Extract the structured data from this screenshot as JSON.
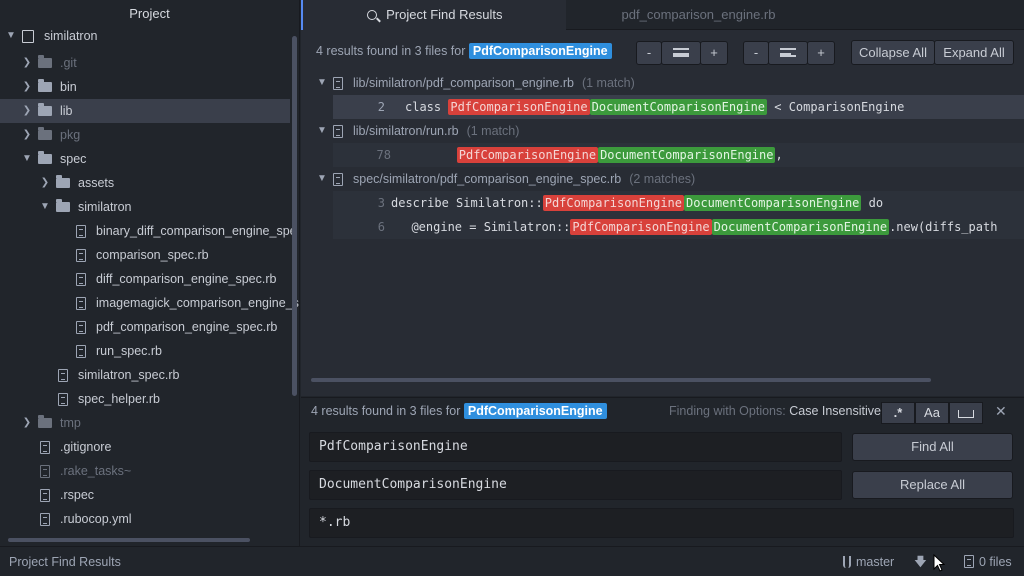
{
  "tree": {
    "title": "Project",
    "root": "similatron",
    "items": [
      {
        "label": ".git",
        "type": "folder"
      },
      {
        "label": "bin",
        "type": "folder"
      },
      {
        "label": "lib",
        "type": "folder"
      },
      {
        "label": "pkg",
        "type": "folder"
      },
      {
        "label": "spec",
        "type": "folder"
      },
      {
        "label": "assets",
        "type": "folder"
      },
      {
        "label": "similatron",
        "type": "folder"
      },
      {
        "label": "binary_diff_comparison_engine_spe",
        "type": "file"
      },
      {
        "label": "comparison_spec.rb",
        "type": "file"
      },
      {
        "label": "diff_comparison_engine_spec.rb",
        "type": "file"
      },
      {
        "label": "imagemagick_comparison_engine_s",
        "type": "file"
      },
      {
        "label": "pdf_comparison_engine_spec.rb",
        "type": "file"
      },
      {
        "label": "run_spec.rb",
        "type": "file"
      },
      {
        "label": "similatron_spec.rb",
        "type": "file"
      },
      {
        "label": "spec_helper.rb",
        "type": "file"
      },
      {
        "label": "tmp",
        "type": "folder"
      },
      {
        "label": ".gitignore",
        "type": "file"
      },
      {
        "label": ".rake_tasks~",
        "type": "file"
      },
      {
        "label": ".rspec",
        "type": "file"
      },
      {
        "label": ".rubocop.yml",
        "type": "file"
      }
    ]
  },
  "tabs": {
    "active": "Project Find Results",
    "inactive": "pdf_comparison_engine.rb"
  },
  "results": {
    "summary_prefix": "4 results found in 3 files for",
    "query": "PdfComparisonEngine",
    "buttons": {
      "minus": "-",
      "plus": "+",
      "collapse_all": "Collapse All",
      "expand_all": "Expand All"
    },
    "files": [
      {
        "path": "lib/similatron/pdf_comparison_engine.rb",
        "count": "(1 match)"
      },
      {
        "path": "lib/similatron/run.rb",
        "count": "(1 match)"
      },
      {
        "path": "spec/similatron/pdf_comparison_engine_spec.rb",
        "count": "(2 matches)"
      }
    ],
    "lines": [
      {
        "no": "2",
        "before": "class ",
        "del": "PdfComparisonEngine",
        "ins": "DocumentComparisonEngine",
        "after": " < ComparisonEngine"
      },
      {
        "no": "78",
        "before": "        ",
        "del": "PdfComparisonEngine",
        "ins": "DocumentComparisonEngine",
        "after": ","
      },
      {
        "no": "3",
        "before": "describe Similatron::",
        "del": "PdfComparisonEngine",
        "ins": "DocumentComparisonEngine",
        "after": " do"
      },
      {
        "no": "6",
        "before": "  @engine = Similatron::",
        "del": "PdfComparisonEngine",
        "ins": "DocumentComparisonEngine",
        "after": ".new(diffs_path"
      }
    ]
  },
  "find": {
    "summary_prefix": "4 results found in 3 files for",
    "query": "PdfComparisonEngine",
    "options_label": "Finding with Options:",
    "options_value": "Case Insensitive",
    "opt_regex": ".*",
    "opt_case": "Aa",
    "close": "✕",
    "find_value": "PdfComparisonEngine",
    "replace_value": "DocumentComparisonEngine",
    "paths_value": "*.rb",
    "find_all": "Find All",
    "replace_all": "Replace All"
  },
  "status": {
    "left": "Project Find Results",
    "branch": "master",
    "files": "0 files"
  }
}
